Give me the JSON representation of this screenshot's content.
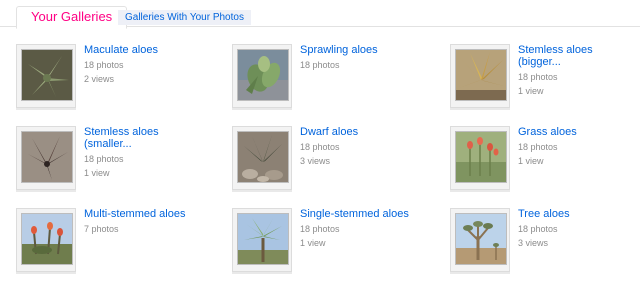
{
  "tabs": {
    "active_label": "Your Galleries",
    "inactive_label": "Galleries With Your Photos"
  },
  "colors": {
    "active_tab_text": "#ff0084",
    "link_blue": "#0063dc",
    "meta_gray": "#8c8c8c"
  },
  "galleries": [
    {
      "title": "Maculate aloes",
      "photos": "18 photos",
      "views": "2 views"
    },
    {
      "title": "Sprawling aloes",
      "photos": "18 photos",
      "views": ""
    },
    {
      "title": "Stemless aloes\n(bigger...",
      "photos": "18 photos",
      "views": "1 view"
    },
    {
      "title": "Stemless aloes\n(smaller...",
      "photos": "18 photos",
      "views": "1 view"
    },
    {
      "title": "Dwarf aloes",
      "photos": "18 photos",
      "views": "3 views"
    },
    {
      "title": "Grass aloes",
      "photos": "18 photos",
      "views": "1 view"
    },
    {
      "title": "Multi-stemmed aloes",
      "photos": "7 photos",
      "views": ""
    },
    {
      "title": "Single-stemmed aloes",
      "photos": "18 photos",
      "views": "1 view"
    },
    {
      "title": "Tree aloes",
      "photos": "18 photos",
      "views": "3 views"
    }
  ]
}
